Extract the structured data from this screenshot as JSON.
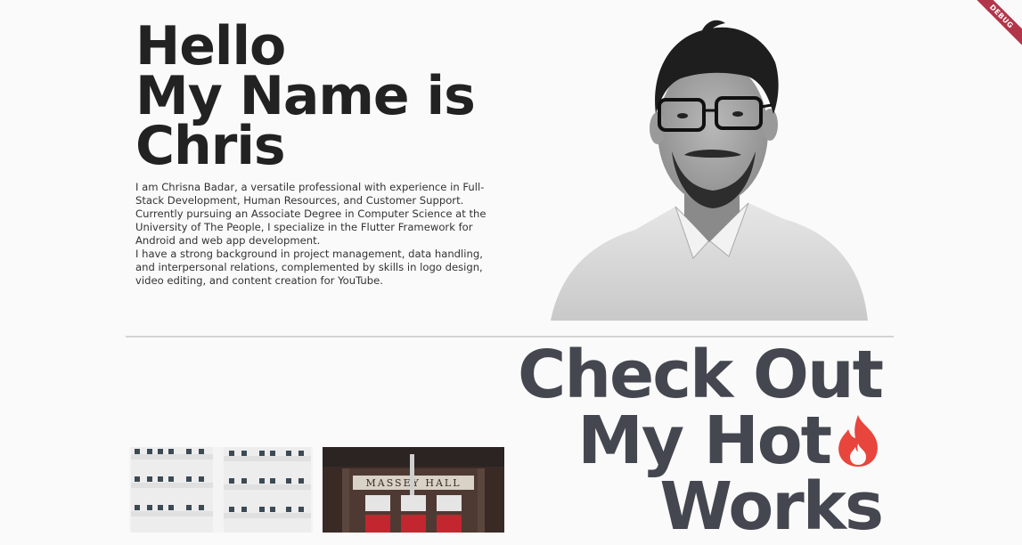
{
  "debug_banner": "DEBUG",
  "hero": {
    "title_lines": [
      "Hello",
      "My Name is",
      "Chris"
    ],
    "bio": [
      "I am Chrisna Badar, a versatile professional with experience in Full-Stack Development, Human Resources, and Customer Support.",
      "Currently pursuing an Associate Degree in Computer Science at the University of The People, I specialize in the Flutter Framework for Android and web app development.",
      "I have a strong background in project management, data handling, and interpersonal relations, complemented by skills in logo design, video editing, and content creation for YouTube."
    ]
  },
  "works": {
    "title_lines": [
      "Check Out",
      "My Hot",
      "Works"
    ],
    "title_icon": "fire-icon",
    "accent_color": "#e8453c",
    "thumbnails": [
      {
        "icon": "building-facade-image"
      },
      {
        "icon": "hall-entrance-image",
        "sign_text": "MASSEY HALL"
      }
    ]
  },
  "colors": {
    "background": "#fafafa",
    "hero_text": "#222222",
    "works_text": "#44474f",
    "divider": "#d4d4d4"
  }
}
